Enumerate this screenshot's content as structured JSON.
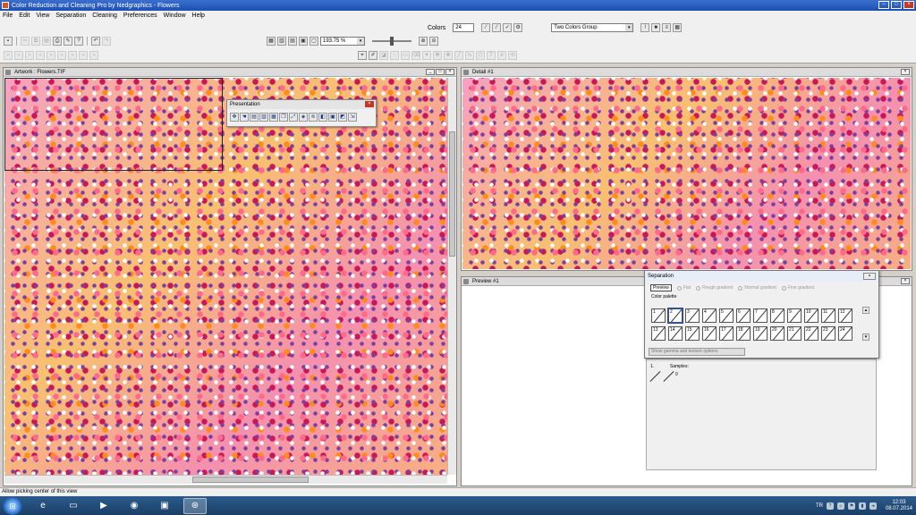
{
  "window": {
    "title": "Color Reduction and Cleaning Pro by Nedgraphics - Flowers",
    "controls": {
      "minimize": "–",
      "maximize": "□",
      "close": "×"
    }
  },
  "menu": [
    "File",
    "Edit",
    "View",
    "Separation",
    "Cleaning",
    "Preferences",
    "Window",
    "Help"
  ],
  "toolbar": {
    "colors_label": "Colors",
    "colors_value": "24",
    "zoom_value": "193.75 %",
    "group_select": "Two Colors Group"
  },
  "artwork_window": {
    "title": "Artwork : Flowers.TIF"
  },
  "detail_window": {
    "title": "Detail #1"
  },
  "preview_window": {
    "title": "Preview #1"
  },
  "presentation_toolbar": {
    "title": "Presentation"
  },
  "separation_dialog": {
    "title": "Separation",
    "modes": [
      {
        "label": "Preview",
        "active": true
      },
      {
        "label": "Flat",
        "active": false
      },
      {
        "label": "Rough gradient",
        "active": false
      },
      {
        "label": "Normal gradient",
        "active": false
      },
      {
        "label": "Fine gradient",
        "active": false
      }
    ],
    "palette_label": "Color palette",
    "palette_row1": [
      "1",
      "2",
      "3",
      "4",
      "5",
      "6",
      "7",
      "8",
      "9",
      "10",
      "11",
      "12"
    ],
    "palette_row2": [
      "13",
      "14",
      "15",
      "16",
      "17",
      "18",
      "19",
      "20",
      "21",
      "22",
      "23",
      "24"
    ],
    "selected_swatch": "2",
    "show_options": "Show gamma and texture options"
  },
  "samples": {
    "index": "1.",
    "label": "Samples:",
    "count": "0"
  },
  "statusbar": {
    "text": "Allow picking center of this view"
  },
  "taskbar": {
    "language": "TR",
    "time": "12:03",
    "date": "08.07.2014"
  },
  "pattern_colors": [
    "#f39ab0",
    "#ff6a8a",
    "#ffffff",
    "#7a3fa0",
    "#ff8c1a",
    "#c8185a",
    "#f8c070"
  ]
}
